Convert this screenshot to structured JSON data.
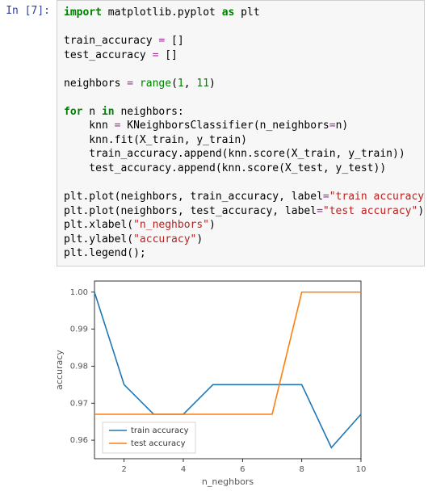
{
  "prompt": "In [7]:",
  "code_tokens": [
    [
      [
        "kw",
        "import"
      ],
      [
        "nm",
        " matplotlib.pyplot "
      ],
      [
        "kw",
        "as"
      ],
      [
        "nm",
        " plt"
      ]
    ],
    [],
    [
      [
        "nm",
        "train_accuracy "
      ],
      [
        "op",
        "="
      ],
      [
        "nm",
        " []"
      ]
    ],
    [
      [
        "nm",
        "test_accuracy "
      ],
      [
        "op",
        "="
      ],
      [
        "nm",
        " []"
      ]
    ],
    [],
    [
      [
        "nm",
        "neighbors "
      ],
      [
        "op",
        "="
      ],
      [
        "nm",
        " "
      ],
      [
        "bi",
        "range"
      ],
      [
        "nm",
        "("
      ],
      [
        "num",
        "1"
      ],
      [
        "nm",
        ", "
      ],
      [
        "num",
        "11"
      ],
      [
        "nm",
        ")"
      ]
    ],
    [],
    [
      [
        "kw",
        "for"
      ],
      [
        "nm",
        " n "
      ],
      [
        "kw",
        "in"
      ],
      [
        "nm",
        " neighbors:"
      ]
    ],
    [
      [
        "nm",
        "    knn "
      ],
      [
        "op",
        "="
      ],
      [
        "nm",
        " KNeighborsClassifier(n_neighbors"
      ],
      [
        "op",
        "="
      ],
      [
        "nm",
        "n)"
      ]
    ],
    [
      [
        "nm",
        "    knn.fit(X_train, y_train)"
      ]
    ],
    [
      [
        "nm",
        "    train_accuracy.append(knn.score(X_train, y_train))"
      ]
    ],
    [
      [
        "nm",
        "    test_accuracy.append(knn.score(X_test, y_test))"
      ]
    ],
    [],
    [
      [
        "nm",
        "plt.plot(neighbors, train_accuracy, label"
      ],
      [
        "op",
        "="
      ],
      [
        "str",
        "\"train accuracy\""
      ],
      [
        "nm",
        ")"
      ]
    ],
    [
      [
        "nm",
        "plt.plot(neighbors, test_accuracy, label"
      ],
      [
        "op",
        "="
      ],
      [
        "str",
        "\"test accuracy\""
      ],
      [
        "nm",
        ")"
      ]
    ],
    [
      [
        "nm",
        "plt.xlabel("
      ],
      [
        "str",
        "\"n_neghbors\""
      ],
      [
        "nm",
        ")"
      ]
    ],
    [
      [
        "nm",
        "plt.ylabel("
      ],
      [
        "str",
        "\"accuracy\""
      ],
      [
        "nm",
        ")"
      ]
    ],
    [
      [
        "nm",
        "plt.legend();"
      ]
    ]
  ],
  "chart_data": {
    "type": "line",
    "title": "",
    "xlabel": "n_neghbors",
    "ylabel": "accuracy",
    "xlim": [
      1,
      10
    ],
    "ylim": [
      0.955,
      1.003
    ],
    "xticks": [
      2,
      4,
      6,
      8,
      10
    ],
    "yticks": [
      0.96,
      0.97,
      0.98,
      0.99,
      1.0
    ],
    "series": [
      {
        "name": "train accuracy",
        "color": "#1f77b4",
        "x": [
          1,
          2,
          3,
          4,
          5,
          6,
          7,
          8,
          9,
          10
        ],
        "y": [
          1.0,
          0.975,
          0.967,
          0.967,
          0.975,
          0.975,
          0.975,
          0.975,
          0.958,
          0.967
        ]
      },
      {
        "name": "test accuracy",
        "color": "#ff7f0e",
        "x": [
          1,
          2,
          3,
          4,
          5,
          6,
          7,
          8,
          9,
          10
        ],
        "y": [
          0.967,
          0.967,
          0.967,
          0.967,
          0.967,
          0.967,
          0.967,
          1.0,
          1.0,
          1.0
        ]
      }
    ],
    "legend_pos": "lower-left"
  }
}
